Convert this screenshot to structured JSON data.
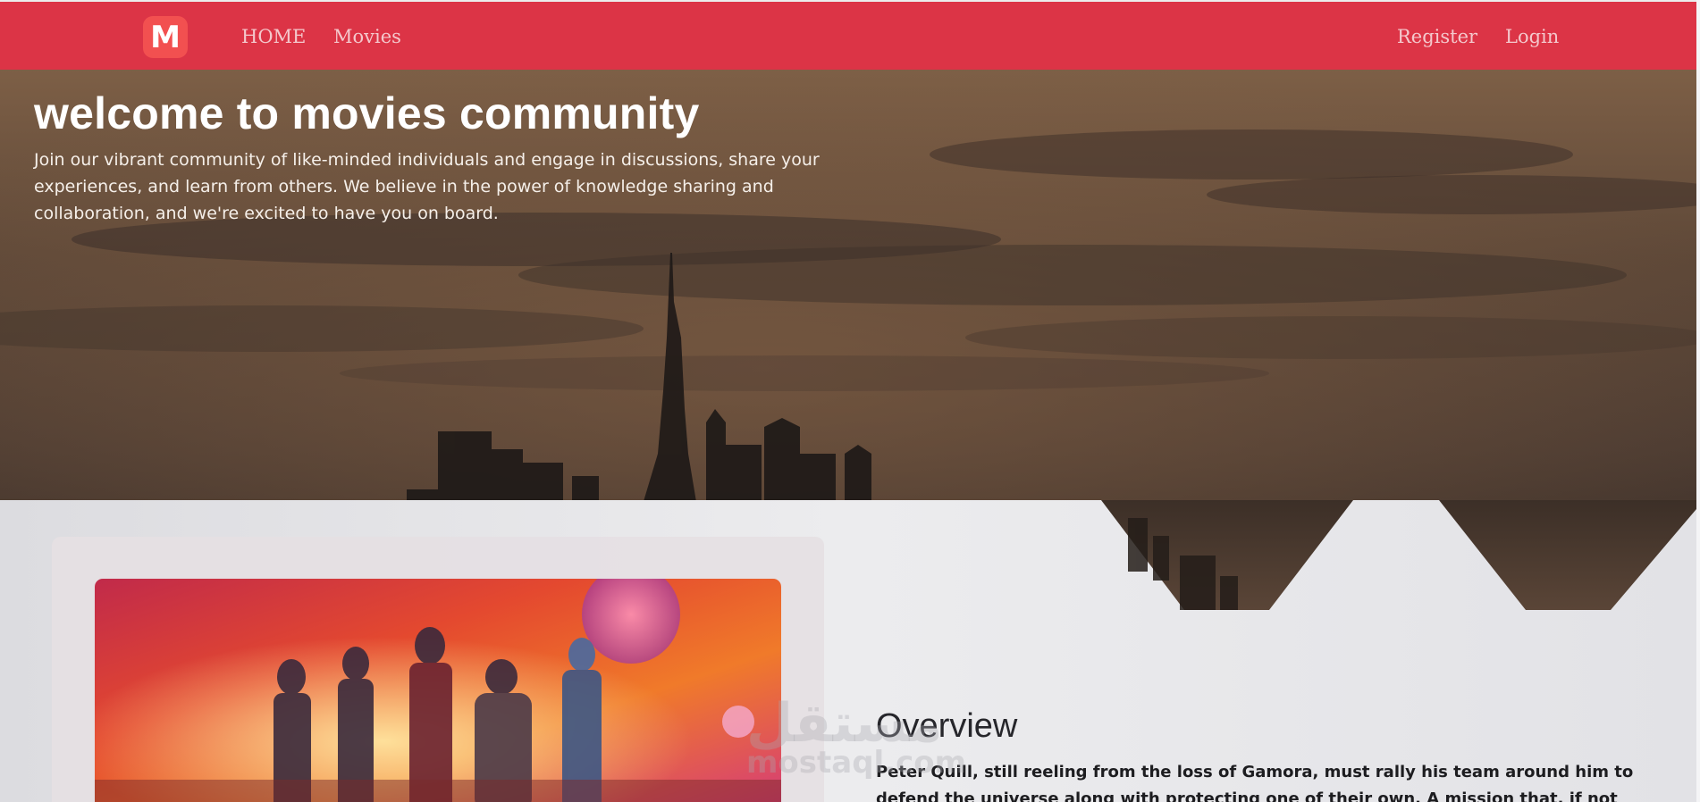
{
  "nav": {
    "logo_letter": "M",
    "home_label": "HOME",
    "movies_label": "Movies",
    "register_label": "Register",
    "login_label": "Login"
  },
  "hero": {
    "title": "welcome to movies community",
    "description": "Join our vibrant community of like-minded individuals and engage in discussions, share your experiences, and learn from others. We believe in the power of knowledge sharing and collaboration, and we're excited to have you on board."
  },
  "overview": {
    "title": "Overview",
    "text": "Peter Quill, still reeling from the loss of Gamora, must rally his team around him to defend the universe along with protecting one of their own. A mission that, if not completed successfully,"
  },
  "watermark": {
    "arabic": "مستقل",
    "latin": "mostaql.com"
  },
  "colors": {
    "navbar": "#dc3446",
    "logo": "#f25050",
    "nav_text": "#f4c8cc"
  },
  "icons": {
    "logo": "logo-m-icon"
  }
}
